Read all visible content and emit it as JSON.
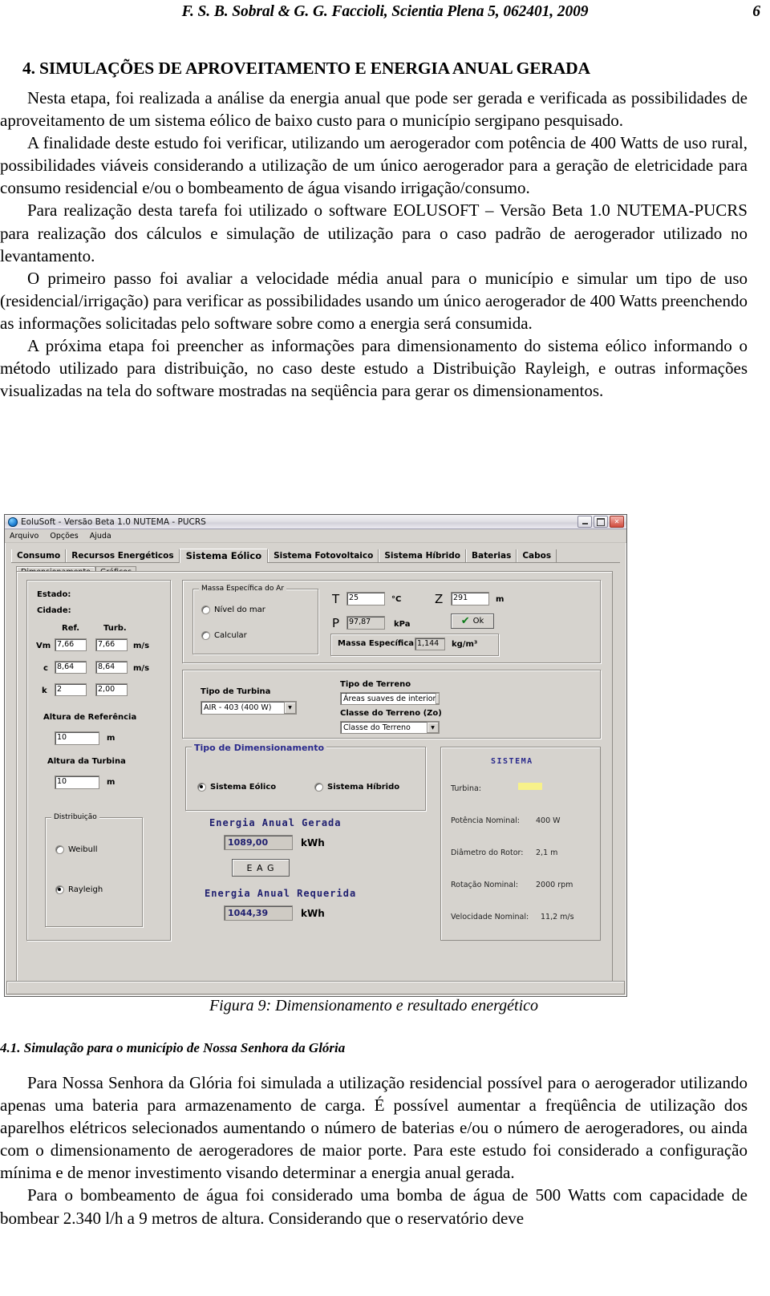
{
  "runhead": {
    "title": "F. S. B. Sobral & G. G. Faccioli, Scientia Plena 5, 062401, 2009",
    "page": "6"
  },
  "section": {
    "title": "4. SIMULAÇÕES DE APROVEITAMENTO E ENERGIA ANUAL GERADA",
    "p1": "Nesta etapa, foi realizada a análise da energia anual que pode ser gerada e verificada as possibilidades de aproveitamento de um sistema eólico de baixo custo para o município sergipano pesquisado.",
    "p2": "A finalidade deste estudo foi verificar, utilizando um aerogerador com potência de 400 Watts de uso rural, possibilidades viáveis considerando a utilização de um único aerogerador para a geração de eletricidade para consumo residencial e/ou o bombeamento de água visando irrigação/consumo.",
    "p3": "Para realização desta tarefa foi utilizado o software EOLUSOFT – Versão Beta 1.0 NUTEMA-PUCRS para realização dos cálculos e simulação de utilização para o caso padrão de aerogerador utilizado no levantamento.",
    "p4": "O primeiro passo foi avaliar a velocidade média anual para o município e simular um tipo de uso (residencial/irrigação) para verificar as possibilidades usando um único aerogerador de 400 Watts preenchendo as informações solicitadas pelo software sobre como a energia será consumida.",
    "p5": "A próxima etapa foi preencher as informações para dimensionamento do sistema eólico informando o método utilizado para distribuição, no caso deste estudo a Distribuição Rayleigh, e outras informações visualizadas na tela do software mostradas na seqüência para gerar os dimensionamentos."
  },
  "figure": {
    "caption": "Figura 9: Dimensionamento e resultado energético",
    "window": {
      "title": "EoluSoft - Versão Beta 1.0  NUTEMA - PUCRS",
      "menu": [
        "Arquivo",
        "Opções",
        "Ajuda"
      ],
      "buttons": {
        "minimize": "minimize",
        "maximize": "maximize",
        "close": "close"
      },
      "tabs": [
        "Consumo",
        "Recursos Energéticos",
        "Sistema Eólico",
        "Sistema Fotovoltaico",
        "Sistema Híbrido",
        "Baterias",
        "Cabos"
      ],
      "active_tab": "Sistema Eólico",
      "subtabs": [
        "Dimensionamento",
        "Gráficos"
      ],
      "active_subtab": "Dimensionamento",
      "left_panel": {
        "estado_label": "Estado:",
        "cidade_label": "Cidade:",
        "col_ref": "Ref.",
        "col_turb": "Turb.",
        "rows": [
          {
            "name": "Vm",
            "ref": "7,66",
            "turb": "7,66",
            "unit": "m/s"
          },
          {
            "name": "c",
            "ref": "8,64",
            "turb": "8,64",
            "unit": "m/s"
          },
          {
            "name": "k",
            "ref": "2",
            "turb": "2,00",
            "unit": ""
          }
        ],
        "altura_ref_label": "Altura de Referência",
        "altura_ref_value": "10",
        "altura_ref_unit": "m",
        "altura_turb_label": "Altura da Turbina",
        "altura_turb_value": "10",
        "altura_turb_unit": "m",
        "distribuicao_label": "Distribuição",
        "distribuicao_options": [
          "Weibull",
          "Rayleigh"
        ],
        "distribuicao_selected": "Rayleigh"
      },
      "ar_panel": {
        "group_label": "Massa Específica do Ar",
        "options": [
          "Nível do mar",
          "Calcular"
        ],
        "t_label": "T",
        "t_value": "25",
        "t_unit": "°C",
        "z_label": "Z",
        "z_value": "291",
        "z_unit": "m",
        "p_label": "P",
        "p_value": "97,87",
        "p_unit": "kPa",
        "ok_label": "Ok",
        "massa_label": "Massa Específica =",
        "massa_value": "1,144",
        "massa_unit": "kg/m³"
      },
      "turbina_panel": {
        "tipo_turbina_label": "Tipo de Turbina",
        "tipo_turbina_value": "AIR - 403 (400 W)",
        "tipo_terreno_label": "Tipo de Terreno",
        "tipo_terreno_value": "Áreas suaves de interior",
        "classe_terreno_label": "Classe do Terreno (Zo)",
        "classe_terreno_value": "Classe do Terreno"
      },
      "dimensionamento_panel": {
        "group_label": "Tipo de Dimensionamento",
        "options": [
          "Sistema Eólico",
          "Sistema Híbrido"
        ],
        "selected": "Sistema Eólico",
        "eag_title": "Energia Anual Gerada",
        "eag_value": "1089,00",
        "eag_unit": "kWh",
        "eag_button": "E A G",
        "ear_title": "Energia Anual Requerida",
        "ear_value": "1044,39",
        "ear_unit": "kWh"
      },
      "sistema_panel": {
        "title": "SISTEMA",
        "rows": [
          {
            "label": "Turbina:",
            "value": ""
          },
          {
            "label": "Potência Nominal:",
            "value": "400 W"
          },
          {
            "label": "Diâmetro do Rotor:",
            "value": "2,1 m"
          },
          {
            "label": "Rotação Nominal:",
            "value": "2000 rpm"
          },
          {
            "label": "Velocidade Nominal:",
            "value": "11,2 m/s"
          }
        ]
      }
    }
  },
  "subsection": {
    "title": "4.1. Simulação para o município de Nossa Senhora da Glória",
    "p1": "Para Nossa Senhora da Glória foi simulada a utilização residencial possível para o aerogerador utilizando apenas uma bateria para armazenamento de carga. É possível aumentar a freqüência de utilização dos aparelhos elétricos selecionados aumentando o número de baterias e/ou o número de aerogeradores, ou ainda com o dimensionamento de aerogeradores de maior porte. Para este estudo foi considerado a configuração mínima e de menor investimento visando determinar a energia anual gerada.",
    "p2": "Para o bombeamento de água foi considerado uma bomba de água de 500 Watts com capacidade de bombear 2.340 l/h a 9 metros de altura. Considerando que o reservatório deve"
  },
  "colors": {
    "window_face": "#d6d3ce",
    "accent_navy": "#202070",
    "highlight_yellow": "#f7f18a",
    "close_red": "#cf4a3c"
  }
}
